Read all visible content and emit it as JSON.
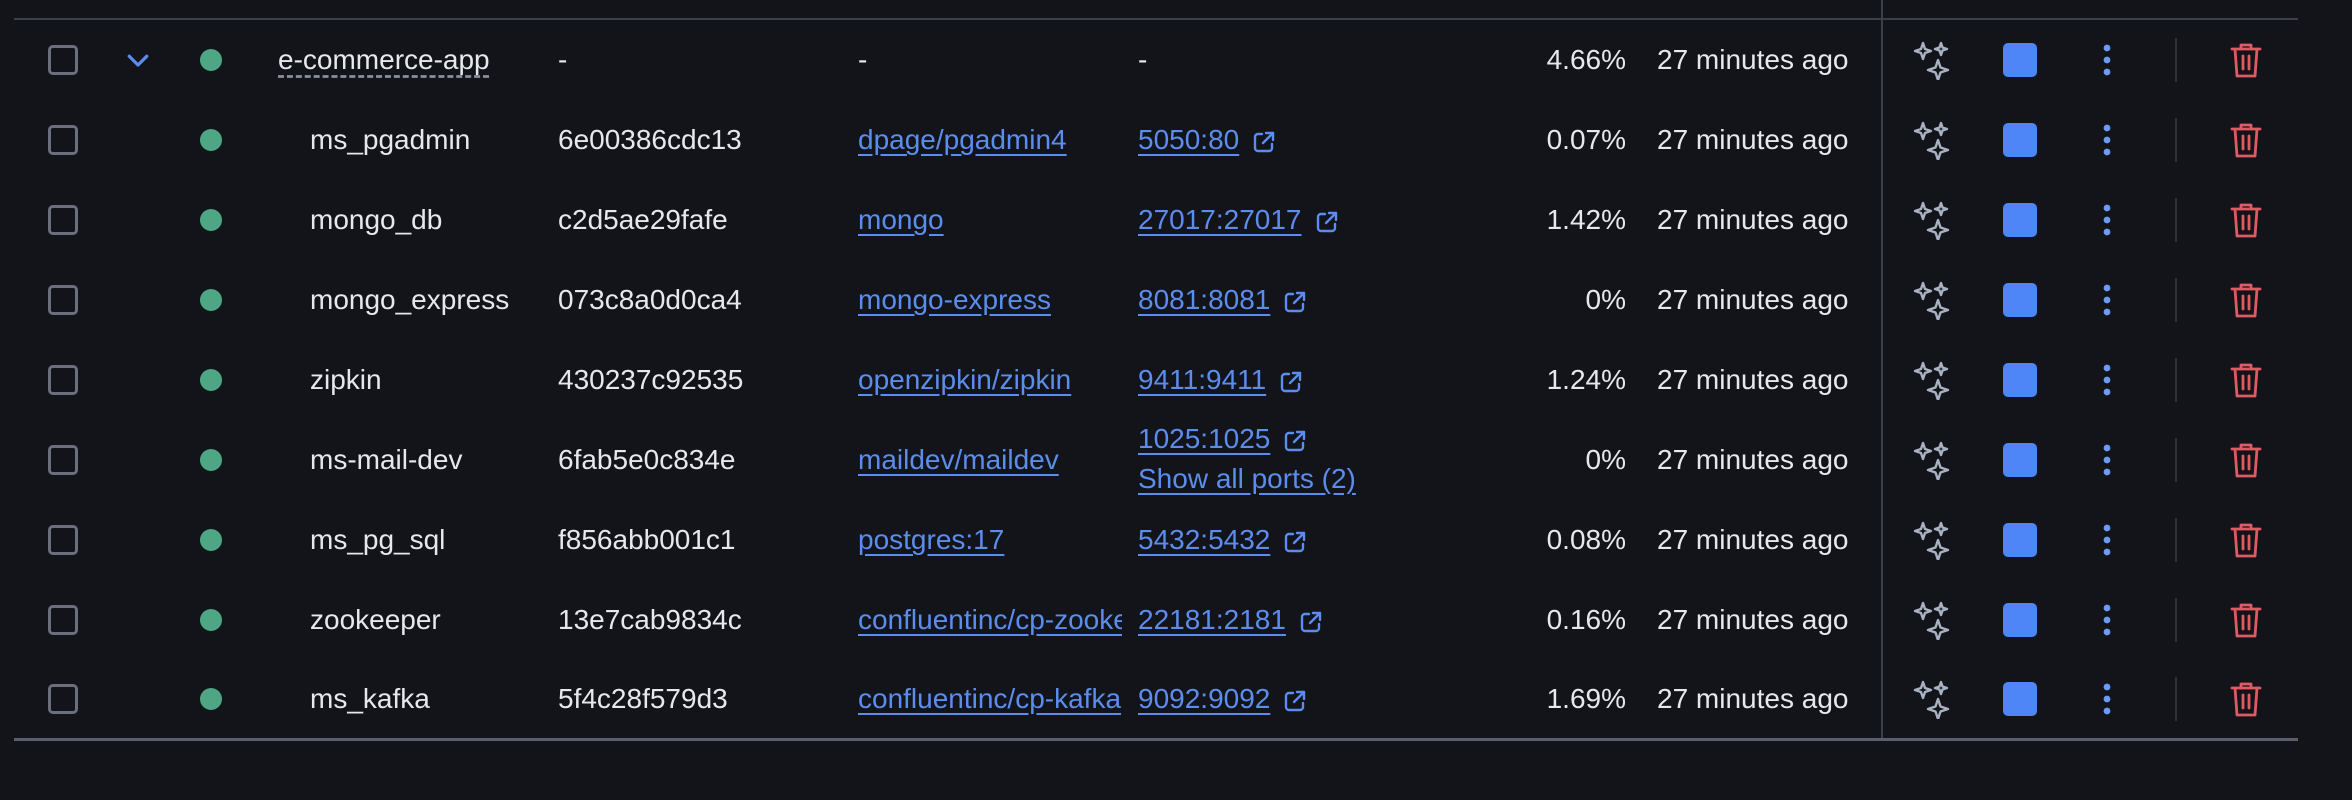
{
  "group": {
    "name": "e-commerce-app",
    "container_id": "-",
    "image": "-",
    "ports": "-",
    "cpu": "4.66%",
    "last_started": "27 minutes ago"
  },
  "containers": [
    {
      "name": "ms_pgadmin",
      "container_id": "6e00386cdc13",
      "image": "dpage/pgadmin4",
      "port": "5050:80",
      "cpu": "0.07%",
      "last_started": "27 minutes ago"
    },
    {
      "name": "mongo_db",
      "container_id": "c2d5ae29fafe",
      "image": "mongo",
      "port": "27017:27017",
      "cpu": "1.42%",
      "last_started": "27 minutes ago"
    },
    {
      "name": "mongo_express",
      "container_id": "073c8a0d0ca4",
      "image": "mongo-express",
      "port": "8081:8081",
      "cpu": "0%",
      "last_started": "27 minutes ago"
    },
    {
      "name": "zipkin",
      "container_id": "430237c92535",
      "image": "openzipkin/zipkin",
      "port": "9411:9411",
      "cpu": "1.24%",
      "last_started": "27 minutes ago"
    },
    {
      "name": "ms-mail-dev",
      "container_id": "6fab5e0c834e",
      "image": "maildev/maildev",
      "port": "1025:1025",
      "show_all": "Show all ports (2)",
      "cpu": "0%",
      "last_started": "27 minutes ago"
    },
    {
      "name": "ms_pg_sql",
      "container_id": "f856abb001c1",
      "image": "postgres:17",
      "port": "5432:5432",
      "cpu": "0.08%",
      "last_started": "27 minutes ago"
    },
    {
      "name": "zookeeper",
      "container_id": "13e7cab9834c",
      "image": "confluentinc/cp-zookeeper",
      "port": "22181:2181",
      "cpu": "0.16%",
      "last_started": "27 minutes ago"
    },
    {
      "name": "ms_kafka",
      "container_id": "5f4c28f579d3",
      "image": "confluentinc/cp-kafka",
      "port": "9092:9092",
      "cpu": "1.69%",
      "last_started": "27 minutes ago"
    }
  ],
  "icons": {
    "expand": "chevron-down-icon",
    "status": "running-status-dot-icon",
    "ai": "sparkles-icon",
    "stop": "stop-icon",
    "more": "more-vertical-icon",
    "delete": "trash-icon",
    "external": "external-link-icon"
  },
  "colors": {
    "background": "#121419",
    "running": "#4ea685",
    "link": "#5b8def",
    "stop": "#4f86f7",
    "delete": "#e05a63"
  }
}
